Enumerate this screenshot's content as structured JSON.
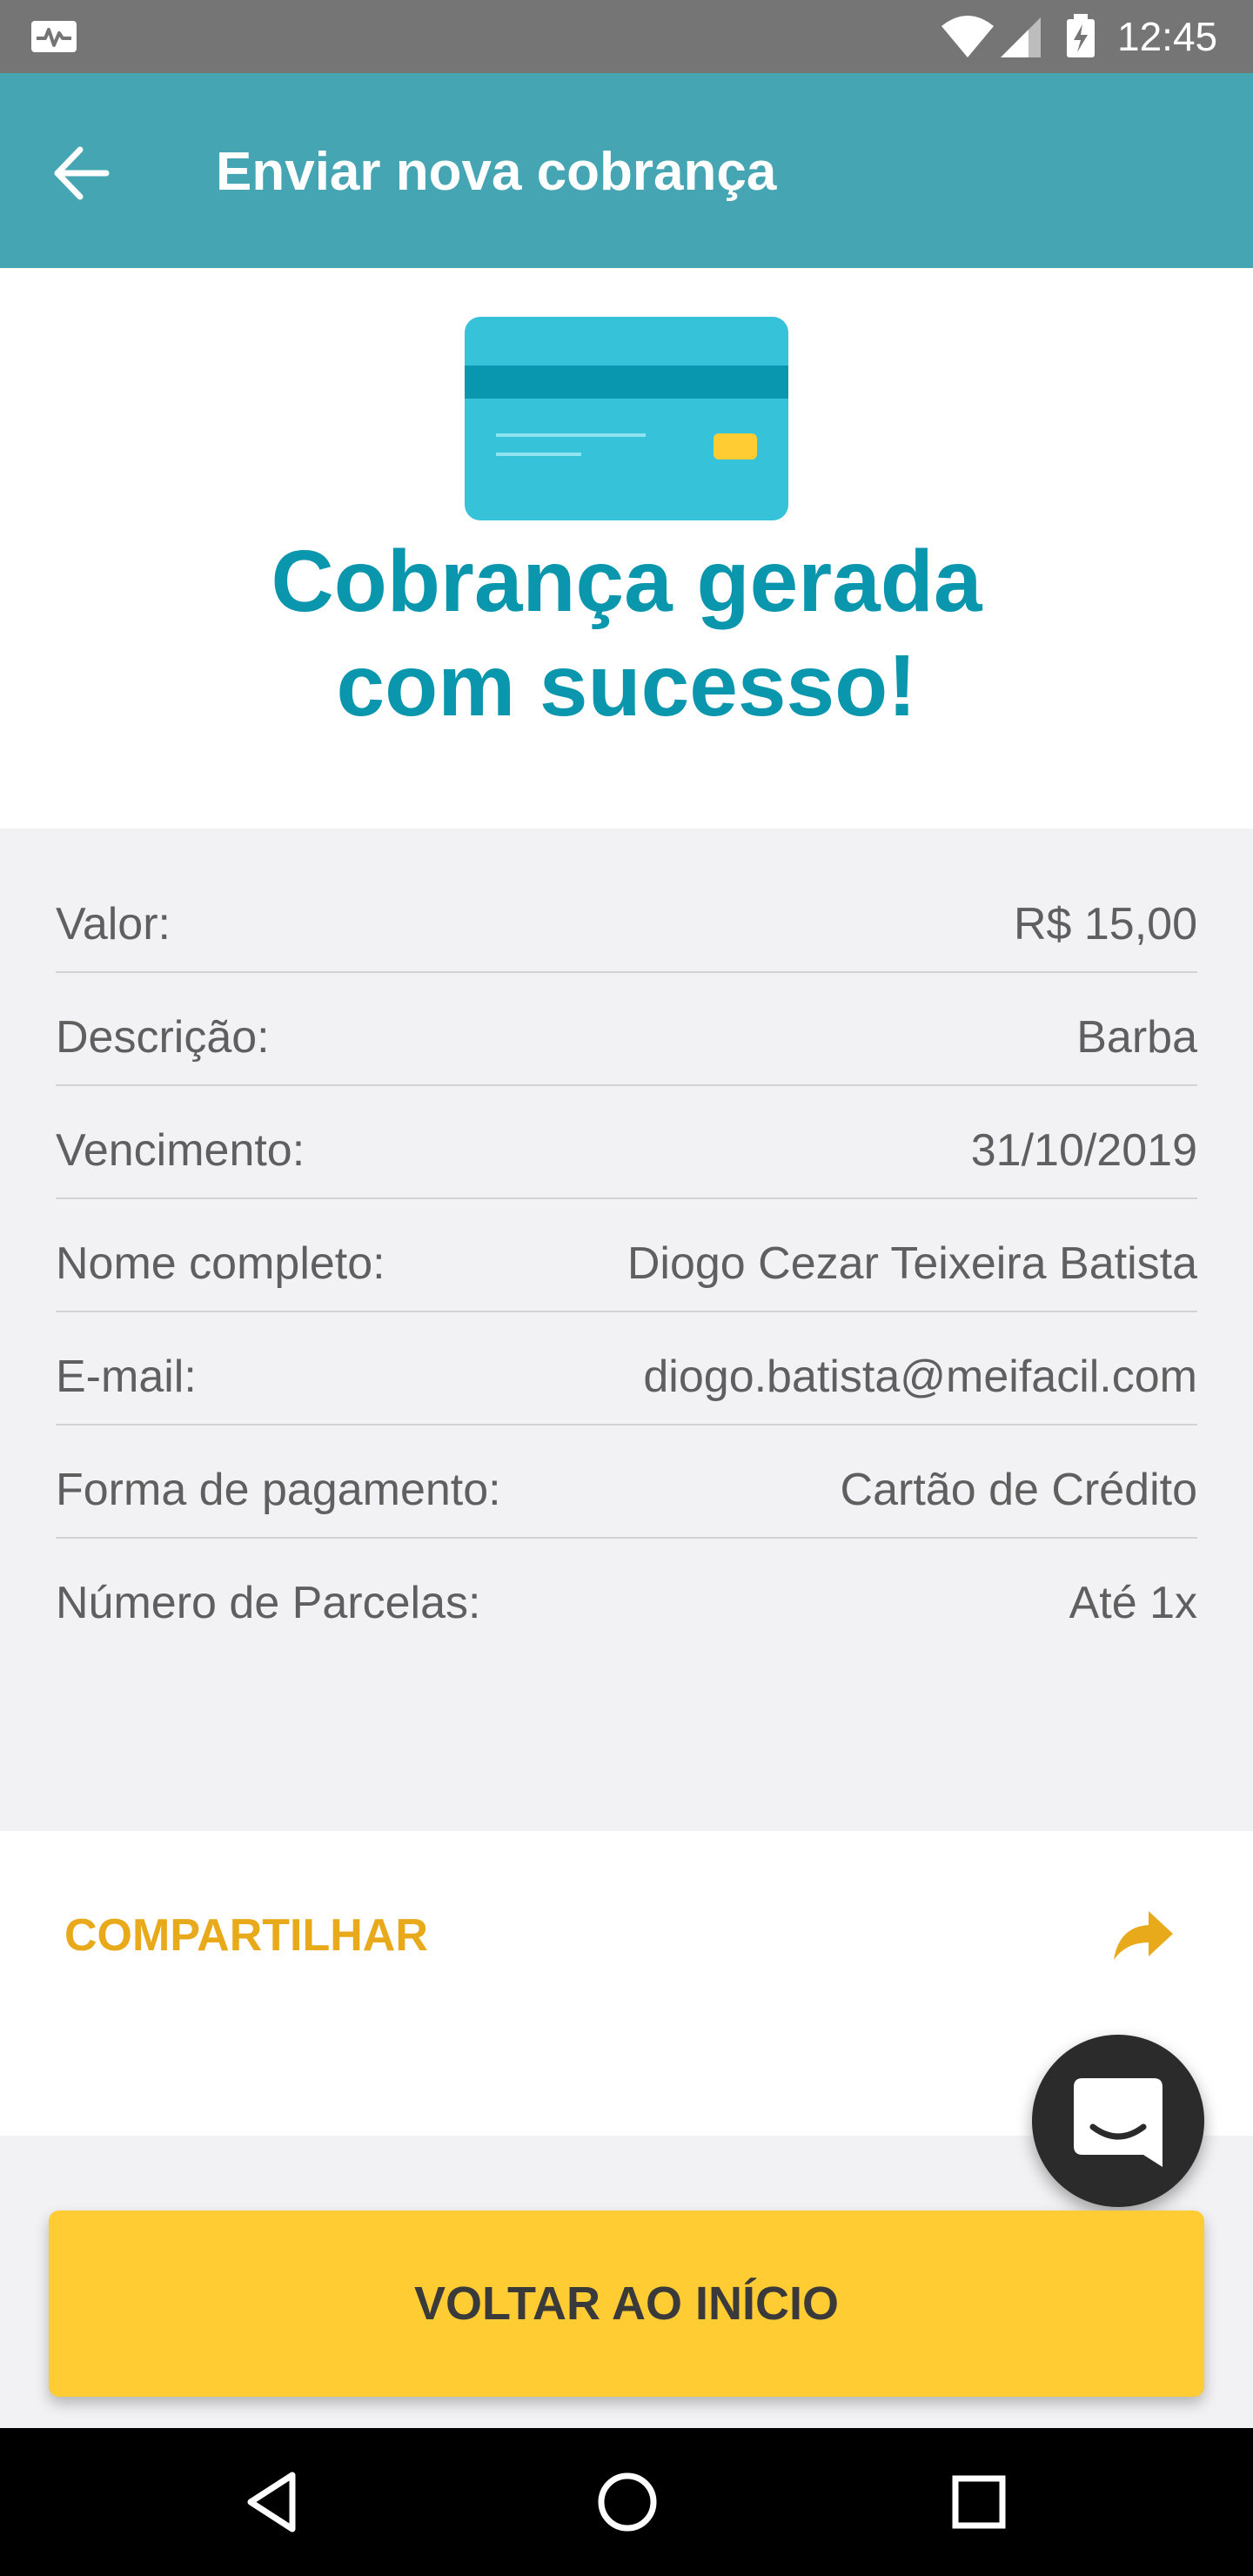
{
  "status_bar": {
    "time": "12:45",
    "icons": [
      "pulse-icon",
      "wifi-icon",
      "signal-icon",
      "battery-charging-icon"
    ]
  },
  "app_bar": {
    "title": "Enviar nova cobrança",
    "back_icon": "arrow-left-icon"
  },
  "hero": {
    "icon": "credit-card-icon",
    "title": "Cobrança gerada com sucesso!"
  },
  "details": [
    {
      "label": "Valor:",
      "value": "R$ 15,00"
    },
    {
      "label": "Descrição:",
      "value": "Barba"
    },
    {
      "label": "Vencimento:",
      "value": "31/10/2019"
    },
    {
      "label": "Nome completo:",
      "value": "Diogo Cezar Teixeira Batista"
    },
    {
      "label": "E-mail:",
      "value": "diogo.batista@meifacil.com"
    },
    {
      "label": "Forma de pagamento:",
      "value": "Cartão de Crédito"
    },
    {
      "label": "Número de Parcelas:",
      "value": "Até 1x"
    }
  ],
  "share": {
    "label": "COMPARTILHAR",
    "icon": "share-arrow-icon"
  },
  "chat": {
    "icon": "chat-bubble-icon"
  },
  "primary_button": {
    "label": "VOLTAR AO INÍCIO"
  },
  "nav_bar": {
    "icons": [
      "nav-back-icon",
      "nav-home-icon",
      "nav-recents-icon"
    ]
  },
  "colors": {
    "app_bar": "#45A5B3",
    "title_accent": "#0A96AC",
    "share_accent": "#E8AA1A",
    "primary_button": "#FFCC33",
    "details_bg": "#F2F2F4"
  }
}
